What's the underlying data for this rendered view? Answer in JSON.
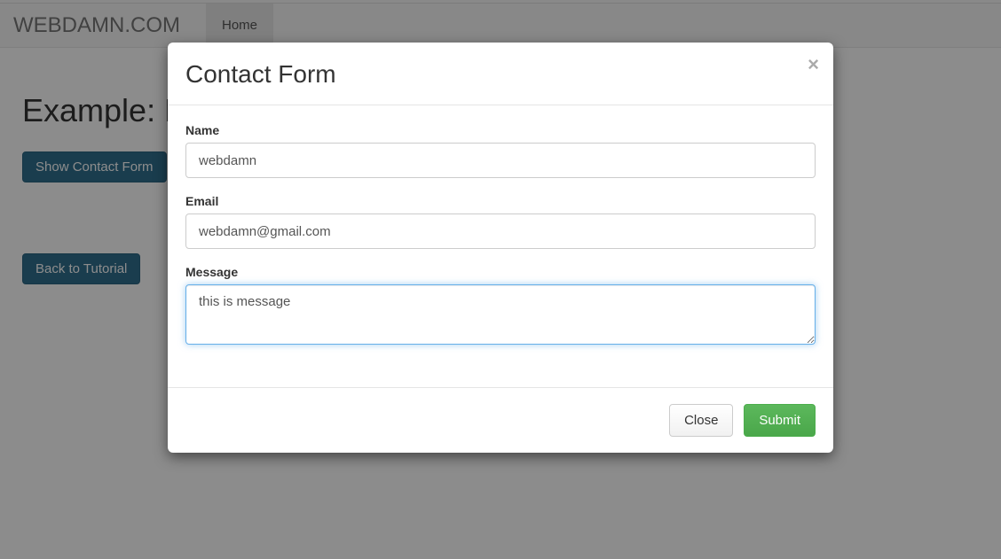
{
  "nav": {
    "brand": "WEBDAMN.COM",
    "home": "Home"
  },
  "page": {
    "heading_visible": "Example: B",
    "show_button": "Show Contact Form",
    "back_button": "Back to Tutorial"
  },
  "modal": {
    "title": "Contact Form",
    "close_symbol": "×",
    "labels": {
      "name": "Name",
      "email": "Email",
      "message": "Message"
    },
    "values": {
      "name": "webdamn",
      "email": "webdamn@gmail.com",
      "message": "this is message"
    },
    "footer": {
      "close": "Close",
      "submit": "Submit"
    }
  }
}
